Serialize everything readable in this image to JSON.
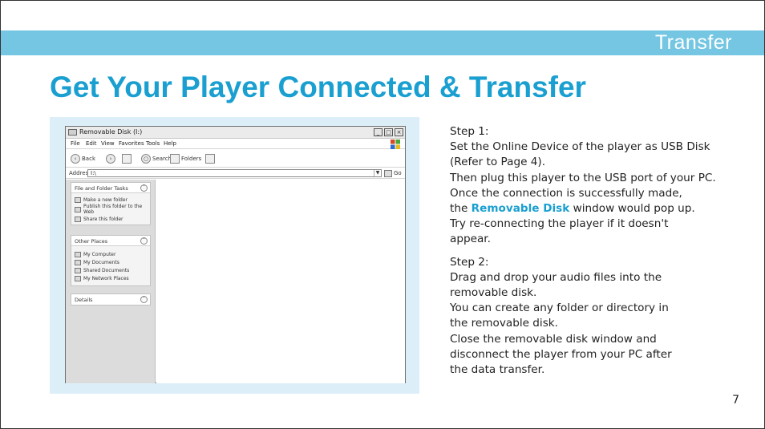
{
  "section_label": "Transfer",
  "page_title": "Get Your Player Connected & Transfer",
  "page_number": "7",
  "screenshot": {
    "window_title": "Removable Disk (I:)",
    "menu": [
      "File",
      "Edit",
      "View",
      "Favorites",
      "Tools",
      "Help"
    ],
    "toolbar": {
      "back": "Back",
      "search": "Search",
      "folders": "Folders"
    },
    "address_label": "Address",
    "address_value": "I:\\",
    "go_label": "Go",
    "panels": [
      {
        "title": "File and Folder Tasks",
        "items": [
          "Make a new folder",
          "Publish this folder to the Web",
          "Share this folder"
        ]
      },
      {
        "title": "Other Places",
        "items": [
          "My Computer",
          "My Documents",
          "Shared Documents",
          "My Network Places"
        ]
      },
      {
        "title": "Details",
        "items": []
      }
    ]
  },
  "steps": {
    "step1": {
      "heading": "Step 1:",
      "line1": "Set the Online Device of the player as USB Disk",
      "line2": "(Refer to Page 4).",
      "line3": "Then plug this player to the USB port of your PC.",
      "line4": "Once the connection is successfully made,",
      "line5_pre": "the ",
      "line5_highlight": "Removable Disk",
      "line5_post": " window would pop up.",
      "line6": "Try re-connecting the player if it doesn't",
      "line7": "appear."
    },
    "step2": {
      "heading": "Step 2:",
      "line1": "Drag and drop your audio files into the",
      "line2": "removable disk.",
      "line3": "You can create any folder or directory in",
      "line4": "the removable disk.",
      "line5": "Close the removable disk window and",
      "line6": "disconnect the player from your PC after",
      "line7": "the data transfer."
    }
  },
  "colors": {
    "accent": "#1a9fd1",
    "band": "#74c6e2",
    "screenshot_bg": "#dceef8"
  }
}
